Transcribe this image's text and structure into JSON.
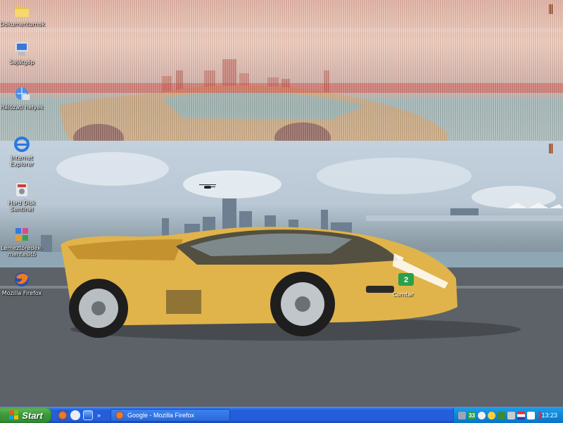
{
  "desktop": {
    "icons": [
      {
        "label": "Dokumentumok"
      },
      {
        "label": "Sajátgép"
      },
      {
        "label": "Hálózati helyek"
      },
      {
        "label": "Internet Explorer"
      },
      {
        "label": "Hard Disk Sentinel"
      },
      {
        "label": "Lemeztöredék-mentesítő"
      },
      {
        "label": "Mozilla Firefox"
      }
    ],
    "car_badge_label": "Comtar"
  },
  "taskbar": {
    "start_label": "Start",
    "quick_launch": [
      "firefox-icon",
      "messenger-icon",
      "window-icon"
    ],
    "overflow_glyph": "»",
    "task": {
      "label": "Google - Mozilla Firefox"
    },
    "tray": {
      "badge": "33",
      "clock": "13:23"
    }
  },
  "colors": {
    "taskbar_blue": "#245edb",
    "start_green": "#3c9b3c",
    "tray_blue": "#0f86d8",
    "car_yellow": "#e0b44a"
  }
}
